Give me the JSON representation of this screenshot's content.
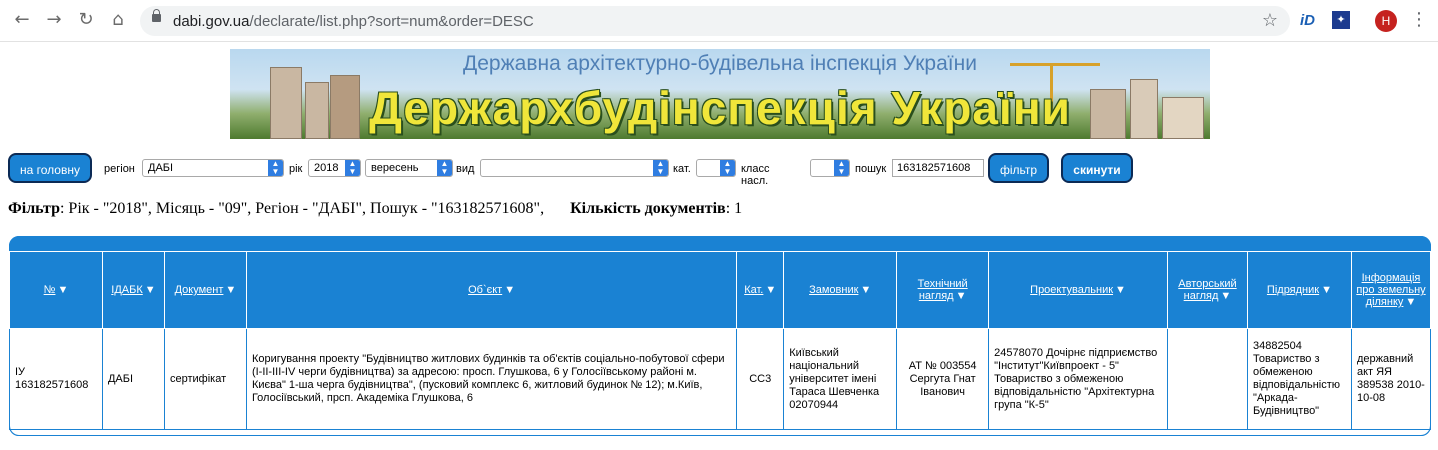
{
  "browser": {
    "url_host": "dabi.gov.ua",
    "url_path": "/declarate/list.php?sort=num&order=DESC",
    "avatar_letter": "H",
    "ext1_label": "iD"
  },
  "banner": {
    "subtitle": "Державна архітектурно-будівельна інспекція України",
    "title": "Держархбудінспекція України"
  },
  "toolbar": {
    "home_label": "на головну",
    "region_label": "регіон",
    "region_value": "ДАБІ",
    "year_label": "рік",
    "year_value": "2018",
    "month_value": "вересень",
    "type_label": "вид",
    "type_value": "",
    "cat_label": "кат.",
    "cat_value": "",
    "class_label": "класс насл.",
    "class_value": "",
    "search_label": "пошук",
    "search_value": "163182571608",
    "filter_label": "фільтр",
    "reset_label": "скинути"
  },
  "filter_summary": {
    "filter_label": "Фільтр",
    "filter_text": ": Рік - \"2018\", Місяць - \"09\", Регіон - \"ДАБІ\", Пошук - \"163182571608\",",
    "count_label": "Кількість документів",
    "count_text": ": 1"
  },
  "table": {
    "headers": [
      "№",
      "ІДАБК",
      "Документ",
      "Об`єкт",
      "Кат.",
      "Замовник",
      "Технічний нагляд",
      "Проектувальник",
      "Авторський нагляд",
      "Підрядник",
      "Інформація про земельну ділянку"
    ],
    "sort_marker": "▼",
    "rows": [
      {
        "num": "ІУ 163182571608",
        "idabk": "ДАБІ",
        "document": "сертифікат",
        "object": "Коригування проекту \"Будівництво житлових будинків та об'єктів соціально-побутової сфери (І-ІІ-ІІІ-ІV черги будівництва) за адресою: просп. Глушкова, 6 у Голосіївському районі м. Києва\" 1-ша черга будівництва\", (пусковий комплекс 6, житловий будинок № 12); м.Київ, Голосіївський, прсп. Академіка Глушкова, 6",
        "cat": "СС3",
        "customer": "Київський національний університет імені Тараса Шевченка 02070944",
        "tech_supervision": "АТ № 003554 Сергута Гнат Іванович",
        "designer": "24578070 Дочірнє підприємство \"Інститут\"Київпроект - 5\" Товариство з обмеженою відповідальністю \"Архітектурна група \"К-5\"",
        "author_supervision": "",
        "contractor": "34882504 Товариство з обмеженою відповідальністю \"Аркада-Будівництво\"",
        "land_info": "державний акт ЯЯ 389538 2010-10-08"
      }
    ]
  }
}
